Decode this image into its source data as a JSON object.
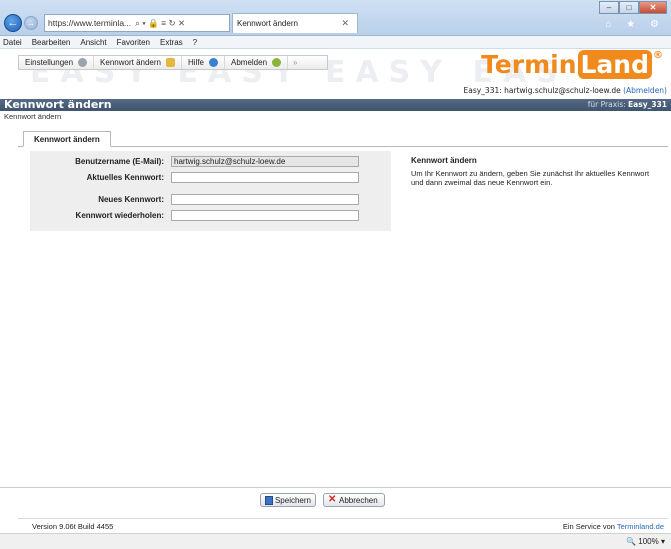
{
  "browser": {
    "address": "https://www.terminla...",
    "address_controls": "⌕ ▾ 🔒 ≡ ↻ ✕",
    "tab_title": "Kennwort ändern",
    "tab_close": "✕",
    "window_controls": [
      "–",
      "□",
      "✕"
    ],
    "chrome_icons": "⌂ ★ ⚙"
  },
  "menu": [
    "Datei",
    "Bearbeiten",
    "Ansicht",
    "Favoriten",
    "Extras",
    "?"
  ],
  "toolbar": {
    "items": [
      {
        "label": "Einstellungen",
        "icon": "gear-icon"
      },
      {
        "label": "Kennwort ändern",
        "icon": "key-icon"
      },
      {
        "label": "Hilfe",
        "icon": "help-icon"
      },
      {
        "label": "Abmelden",
        "icon": "logout-icon"
      }
    ],
    "collapse": "»"
  },
  "header": {
    "watermark": "EASY EASY EASY EAS",
    "brand_part1": "Termin",
    "brand_part2": "Land",
    "brand_reg": "®",
    "user_info": "Easy_331: hartwig.schulz@schulz-loew.de",
    "logout_link": "(Abmelden)"
  },
  "page": {
    "title": "Kennwort ändern",
    "praxis_label": "für Praxis:",
    "praxis_value": "Easy_331",
    "breadcrumb": "Kennwort ändern",
    "tab": "Kennwort ändern"
  },
  "form": {
    "username_label": "Benutzername (E-Mail):",
    "username_value": "hartwig.schulz@schulz-loew.de",
    "current_label": "Aktuelles Kennwort:",
    "current_value": "",
    "new_label": "Neues Kennwort:",
    "new_value": "",
    "repeat_label": "Kennwort wiederholen:",
    "repeat_value": ""
  },
  "help": {
    "title": "Kennwort ändern",
    "text": "Um Ihr Kennwort zu ändern, geben Sie zunächst Ihr aktuelles Kennwort und dann zweimal das neue Kennwort ein."
  },
  "buttons": {
    "save": "Speichern",
    "cancel": "Abbrechen"
  },
  "footer": {
    "version": "Version 9.06t Build 4455",
    "service_text": "Ein Service von",
    "service_link": "Terminland.de"
  },
  "status": {
    "zoom": "100%",
    "zoom_icon": "🔍",
    "zoom_caret": "▾"
  },
  "colors": {
    "brand": "#f08a1d",
    "titlebar": "#4a5f7a",
    "link": "#2a67b8"
  }
}
